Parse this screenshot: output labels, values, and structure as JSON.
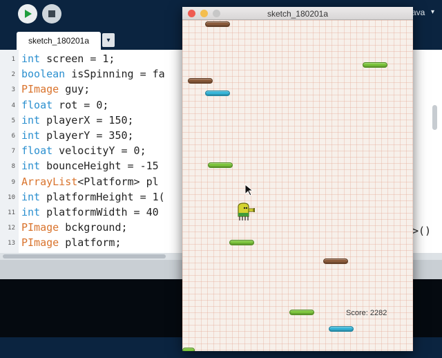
{
  "ide": {
    "mode_label": "ava",
    "tab_label": "sketch_180201a",
    "lines": [
      {
        "n": "1",
        "parts": [
          {
            "t": "int",
            "c": "kw"
          },
          {
            "t": " screen = 1;"
          }
        ]
      },
      {
        "n": "2",
        "parts": [
          {
            "t": "boolean",
            "c": "kw"
          },
          {
            "t": " isSpinning = fa"
          }
        ]
      },
      {
        "n": "3",
        "parts": [
          {
            "t": "PImage",
            "c": "tp"
          },
          {
            "t": " guy;"
          }
        ]
      },
      {
        "n": "4",
        "parts": [
          {
            "t": "float",
            "c": "kw"
          },
          {
            "t": " rot = 0;"
          }
        ]
      },
      {
        "n": "5",
        "parts": [
          {
            "t": "int",
            "c": "kw"
          },
          {
            "t": " playerX = 150;"
          }
        ]
      },
      {
        "n": "6",
        "parts": [
          {
            "t": "int",
            "c": "kw"
          },
          {
            "t": " playerY = 350;"
          }
        ]
      },
      {
        "n": "7",
        "parts": [
          {
            "t": "float",
            "c": "kw"
          },
          {
            "t": " velocityY = 0;"
          }
        ]
      },
      {
        "n": "8",
        "parts": [
          {
            "t": "int",
            "c": "kw"
          },
          {
            "t": " bounceHeight = -15"
          }
        ]
      },
      {
        "n": "9",
        "parts": [
          {
            "t": "ArrayList",
            "c": "tp"
          },
          {
            "t": "<Platform> pl"
          }
        ]
      },
      {
        "n": "10",
        "parts": [
          {
            "t": "int",
            "c": "kw"
          },
          {
            "t": " platformHeight = 1("
          }
        ]
      },
      {
        "n": "11",
        "parts": [
          {
            "t": "int",
            "c": "kw"
          },
          {
            "t": " platformWidth = 40"
          }
        ]
      },
      {
        "n": "12",
        "parts": [
          {
            "t": "PImage",
            "c": "tp"
          },
          {
            "t": " bckground;"
          }
        ]
      },
      {
        "n": "13",
        "parts": [
          {
            "t": "PImage",
            "c": "tp"
          },
          {
            "t": " platform;"
          }
        ]
      }
    ],
    "overflow_text": ">()"
  },
  "sketch": {
    "window_title": "sketch_180201a",
    "score_text": "Score: 2282",
    "platforms": [
      {
        "kind": "brown"
      },
      {
        "kind": "green"
      },
      {
        "kind": "brown"
      },
      {
        "kind": "blue"
      },
      {
        "kind": "green"
      },
      {
        "kind": "green"
      },
      {
        "kind": "brown"
      },
      {
        "kind": "green"
      },
      {
        "kind": "blue"
      },
      {
        "kind": "green"
      }
    ]
  },
  "colors": {
    "ide_background": "#0b2440",
    "keyword": "#2a8fcf",
    "type": "#d9732c",
    "platform_green": "#7cc43c",
    "platform_blue": "#36b5d8",
    "platform_brown": "#8a5a3a"
  }
}
